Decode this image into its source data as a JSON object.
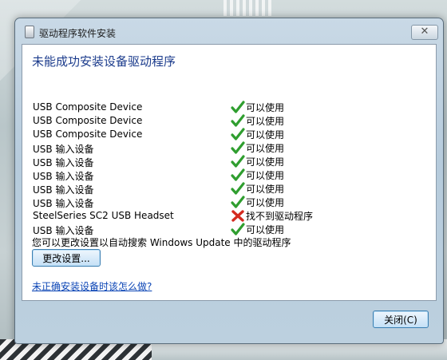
{
  "window": {
    "title": "驱动程序软件安装",
    "close_glyph": "✕"
  },
  "content": {
    "heading": "未能成功安装设备驱动程序",
    "devices": [
      {
        "name": "USB Composite Device",
        "status": "可以使用",
        "status_icon": "check-icon"
      },
      {
        "name": "USB Composite Device",
        "status": "可以使用",
        "status_icon": "check-icon"
      },
      {
        "name": "USB Composite Device",
        "status": "可以使用",
        "status_icon": "check-icon"
      },
      {
        "name": "USB 输入设备",
        "status": "可以使用",
        "status_icon": "check-icon"
      },
      {
        "name": "USB 输入设备",
        "status": "可以使用",
        "status_icon": "check-icon"
      },
      {
        "name": "USB 输入设备",
        "status": "可以使用",
        "status_icon": "check-icon"
      },
      {
        "name": "USB 输入设备",
        "status": "可以使用",
        "status_icon": "check-icon"
      },
      {
        "name": "USB 输入设备",
        "status": "可以使用",
        "status_icon": "check-icon"
      },
      {
        "name": "SteelSeries SC2 USB Headset",
        "status": "找不到驱动程序",
        "status_icon": "error-x-icon"
      },
      {
        "name": "USB 输入设备",
        "status": "可以使用",
        "status_icon": "check-icon"
      }
    ],
    "change_text": "您可以更改设置以自动搜索 Windows Update 中的驱动程序",
    "change_button": "更改设置...",
    "help_link": "未正确安装设备时该怎么做?"
  },
  "footer": {
    "close_button": "关闭(C)"
  },
  "colors": {
    "heading": "#1b3b8c",
    "link": "#0a44b5",
    "check": "#2f9e2f",
    "error": "#d42a1f"
  }
}
